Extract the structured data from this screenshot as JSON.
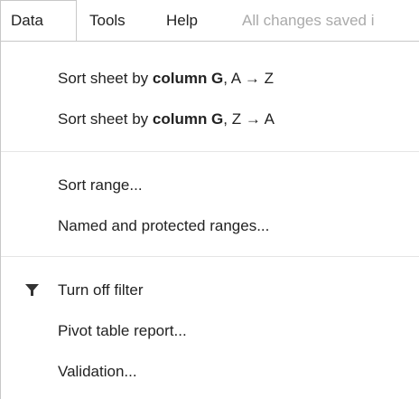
{
  "menubar": {
    "items": [
      {
        "label": "Data"
      },
      {
        "label": "Tools"
      },
      {
        "label": "Help"
      }
    ],
    "status": "All changes saved i"
  },
  "dropdown": {
    "sort_az": {
      "prefix": "Sort sheet by ",
      "bold": "column G",
      "suffix": ", A → Z"
    },
    "sort_za": {
      "prefix": "Sort sheet by ",
      "bold": "column G",
      "suffix": ", Z → A"
    },
    "sort_range": "Sort range...",
    "named_ranges": "Named and protected ranges...",
    "turn_off_filter": "Turn off filter",
    "pivot": "Pivot table report...",
    "validation": "Validation..."
  },
  "icons": {
    "filter": "filter-funnel-icon"
  }
}
